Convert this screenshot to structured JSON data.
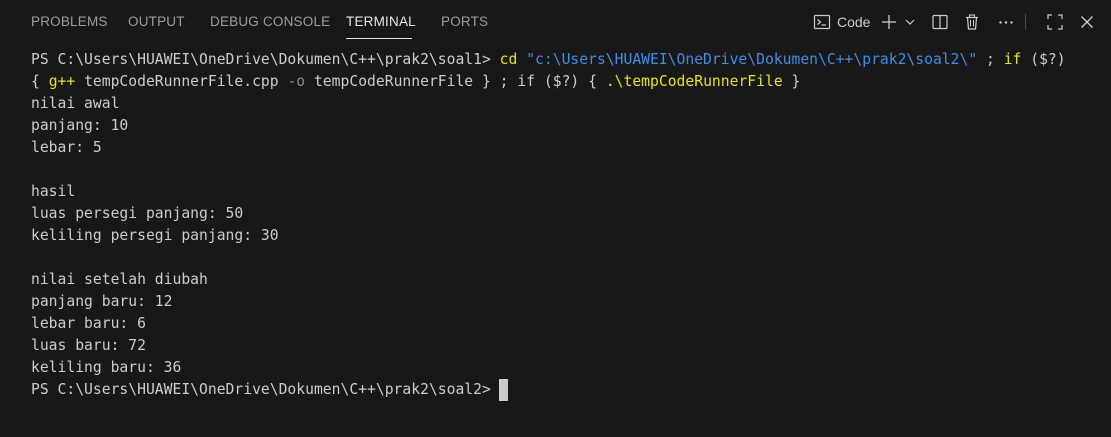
{
  "tabs": {
    "problems": "PROBLEMS",
    "output": "OUTPUT",
    "debug_console": "DEBUG CONSOLE",
    "terminal": "TERMINAL",
    "ports": "PORTS"
  },
  "actions": {
    "terminal_name": "Code"
  },
  "terminal": {
    "prompt1": "PS C:\\Users\\HUAWEI\\OneDrive\\Dokumen\\C++\\prak2\\soal1>",
    "cd_cmd": "cd",
    "cd_path": "\"c:\\Users\\HUAWEI\\OneDrive\\Dokumen\\C++\\prak2\\soal2\\\"",
    "cmd_sep1": " ; ",
    "if1": "if",
    "cond1": "($?)",
    "brace_open1": "{",
    "gpp": "g++",
    "gpp_args": "tempCodeRunnerFile.cpp",
    "flag_o": "-o",
    "out_name": "tempCodeRunnerFile",
    "brace_close1": "}",
    "cmd_sep2": " ; ",
    "if2": "if",
    "cond2": "($?)",
    "brace_open2": "{",
    "run_cmd": ".\\tempCodeRunnerFile",
    "brace_close2": "}",
    "output_lines": [
      "nilai awal",
      "panjang: 10",
      "lebar: 5",
      "",
      "hasil",
      "luas persegi panjang: 50",
      "keliling persegi panjang: 30",
      "",
      "nilai setelah diubah",
      "panjang baru: 12",
      "lebar baru: 6",
      "luas baru: 72",
      "keliling baru: 36"
    ],
    "prompt2": "PS C:\\Users\\HUAWEI\\OneDrive\\Dokumen\\C++\\prak2\\soal2>"
  },
  "colors": {
    "background": "#181818",
    "text": "#cccccc",
    "command_yellow": "#e5e510",
    "string_blue": "#3b8eea",
    "flag_gray": "#8a8a8a"
  }
}
